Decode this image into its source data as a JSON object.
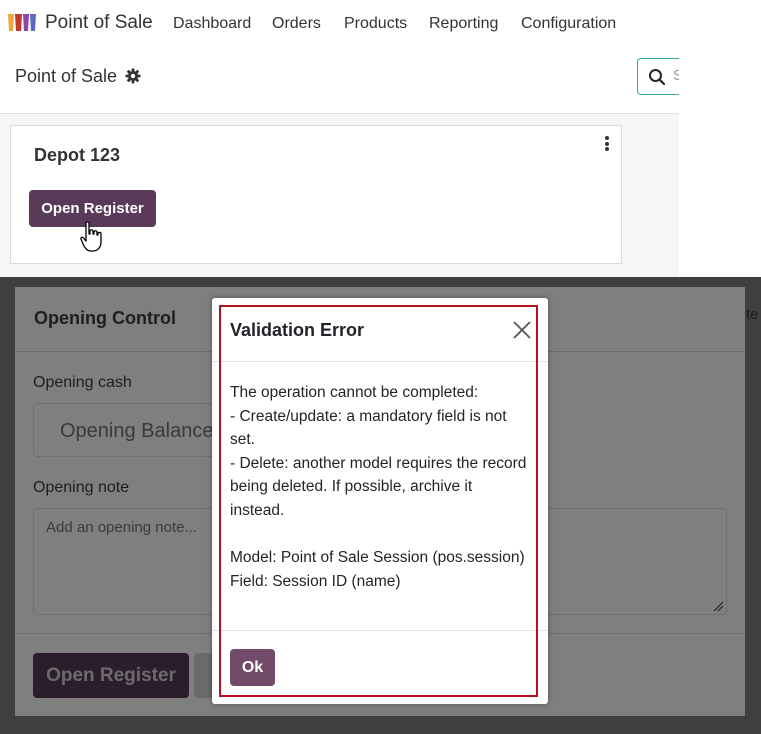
{
  "navbar": {
    "app_name": "Point of Sale",
    "menu": [
      "Dashboard",
      "Orders",
      "Products",
      "Reporting",
      "Configuration"
    ]
  },
  "control_panel": {
    "title": "Point of Sale",
    "search_placeholder": "S"
  },
  "card": {
    "title": "Depot 123",
    "button_label": "Open Register"
  },
  "opening_control": {
    "title": "Opening Control",
    "side_text": "te",
    "cash_label": "Opening cash",
    "cash_placeholder": "Opening Balance",
    "note_label": "Opening note",
    "note_placeholder": "Add an opening note...",
    "button_label": "Open Register"
  },
  "dialog": {
    "title": "Validation Error",
    "body": [
      "The operation cannot be completed:",
      "- Create/update: a mandatory field is not set.",
      "- Delete: another model requires the record being deleted. If possible, archive it instead.",
      "",
      "Model: Point of Sale Session (pos.session)",
      "Field: Session ID (name)"
    ],
    "ok_label": "Ok"
  },
  "colors": {
    "brand_primary": "#714b67",
    "button_dark": "#593a58",
    "search_border": "#3aa7a3",
    "highlight": "#b3121c"
  }
}
